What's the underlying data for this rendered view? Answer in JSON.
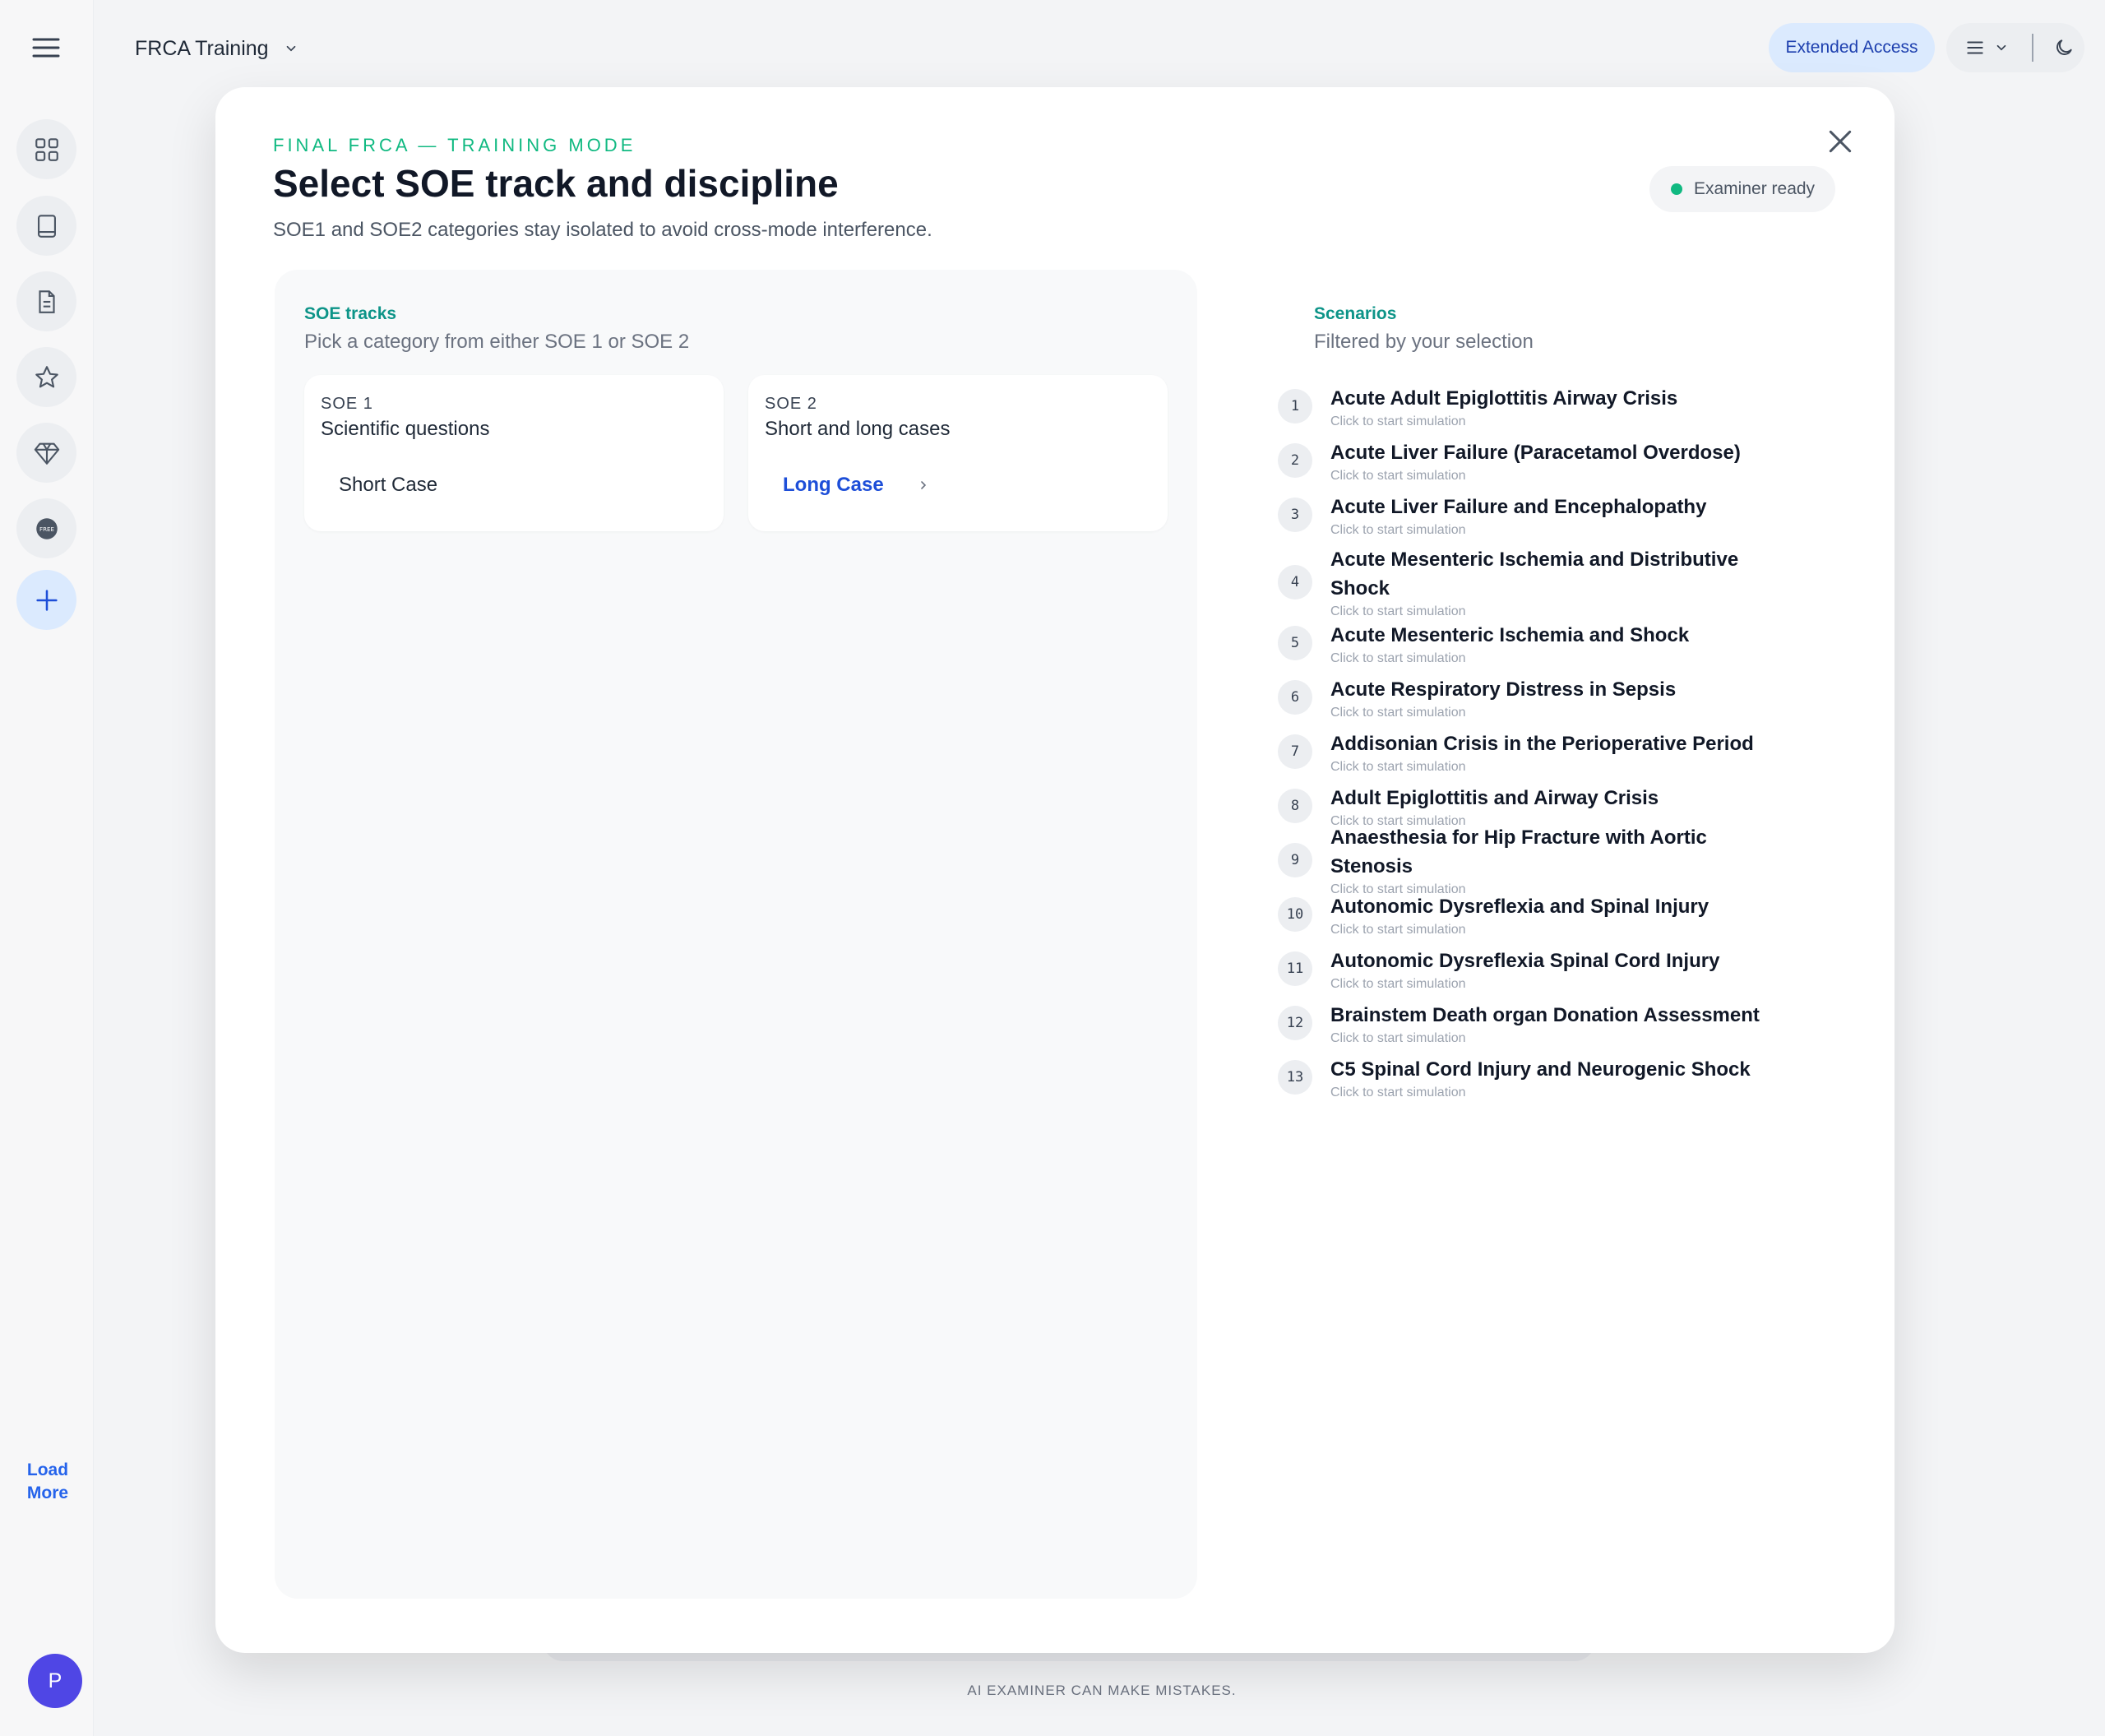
{
  "top_bar": {
    "app_switcher_label": "FRCA Training",
    "extended_access_label": "Extended Access"
  },
  "sidebar": {
    "load_more_label": "Load More",
    "avatar_initial": "P"
  },
  "modal": {
    "eyebrow": "FINAL FRCA — TRAINING MODE",
    "title": "Select SOE track and discipline",
    "subtitle": "SOE1 and SOE2 categories stay isolated to avoid cross-mode interference.",
    "status_label": "Examiner ready",
    "tracks": {
      "heading": "SOE tracks",
      "subheading": "Pick a category from either SOE 1 or SOE 2",
      "cards": [
        {
          "code": "SOE 1",
          "description": "Scientific questions",
          "option": "Short Case",
          "selected": false
        },
        {
          "code": "SOE 2",
          "description": "Short and long cases",
          "option": "Long Case",
          "selected": true
        }
      ]
    },
    "scenarios": {
      "heading": "Scenarios",
      "subheading": "Filtered by your selection",
      "hint": "Click to start simulation",
      "items": [
        {
          "num": "1",
          "name": "Acute Adult Epiglottitis Airway Crisis"
        },
        {
          "num": "2",
          "name": "Acute Liver Failure (Paracetamol Overdose)"
        },
        {
          "num": "3",
          "name": "Acute Liver Failure and Encephalopathy"
        },
        {
          "num": "4",
          "name": "Acute Mesenteric Ischemia and Distributive Shock"
        },
        {
          "num": "5",
          "name": "Acute Mesenteric Ischemia and Shock"
        },
        {
          "num": "6",
          "name": "Acute Respiratory Distress in Sepsis"
        },
        {
          "num": "7",
          "name": "Addisonian Crisis in the Perioperative Period"
        },
        {
          "num": "8",
          "name": "Adult Epiglottitis and Airway Crisis"
        },
        {
          "num": "9",
          "name": "Anaesthesia for Hip Fracture with Aortic Stenosis"
        },
        {
          "num": "10",
          "name": "Autonomic Dysreflexia and Spinal Injury"
        },
        {
          "num": "11",
          "name": "Autonomic Dysreflexia Spinal Cord Injury"
        },
        {
          "num": "12",
          "name": "Brainstem Death organ Donation Assessment"
        },
        {
          "num": "13",
          "name": "C5 Spinal Cord Injury and Neurogenic Shock"
        }
      ]
    }
  },
  "footer": {
    "disclaimer": "AI EXAMINER CAN MAKE MISTAKES."
  },
  "colors": {
    "accent_teal": "#0d9488",
    "accent_green": "#10b981",
    "link_blue": "#1d4ed8",
    "avatar": "#4f46e5"
  },
  "icons": [
    "menu-icon",
    "grid-icon",
    "book-icon",
    "document-icon",
    "star-icon",
    "gem-icon",
    "free-badge-icon",
    "plus-icon",
    "chevron-down-icon",
    "close-icon",
    "moon-icon",
    "chevron-right-icon"
  ]
}
